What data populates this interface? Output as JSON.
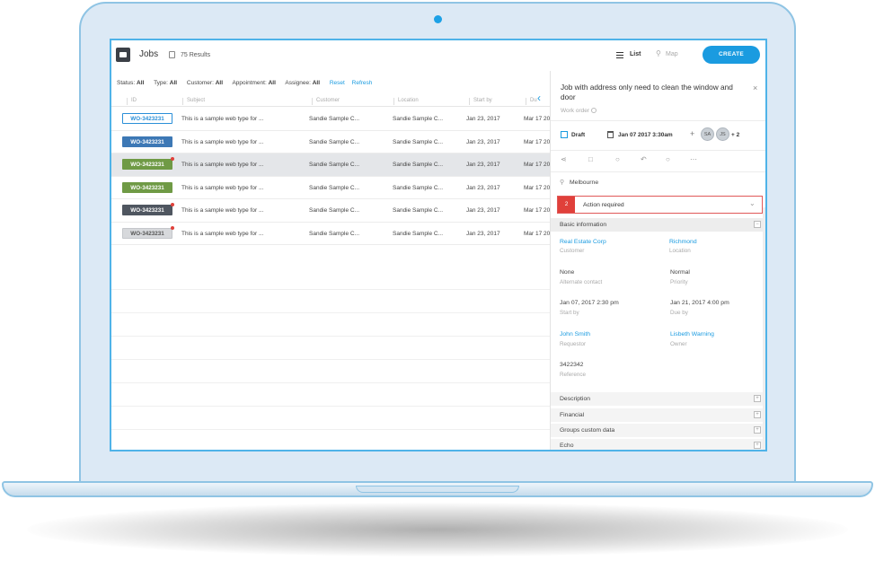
{
  "header": {
    "title": "Jobs",
    "results": "75 Results",
    "list_label": "List",
    "map_label": "Map",
    "create_label": "CREATE"
  },
  "filters": [
    {
      "label": "Status:",
      "value": "All"
    },
    {
      "label": "Type:",
      "value": "All"
    },
    {
      "label": "Customer:",
      "value": "All"
    },
    {
      "label": "Appointment:",
      "value": "All"
    },
    {
      "label": "Assignee:",
      "value": "All"
    }
  ],
  "filter_links": {
    "reset": "Reset",
    "refresh": "Refresh"
  },
  "table": {
    "columns": [
      "ID",
      "Subject",
      "Customer",
      "Location",
      "Start by",
      "Du"
    ],
    "rows": [
      {
        "id": "WO-3423231",
        "subject": "This is a sample web type for ...",
        "customer": "Sandie Sample C...",
        "location": "Sandie Sample C...",
        "start": "Jan 23, 2017",
        "due": "Mar 17 20",
        "badge_bg": "#ffffff",
        "badge_fg": "#2a8fd8",
        "badge_border": "#2a8fd8",
        "dot": false,
        "selected": false
      },
      {
        "id": "WO-3423231",
        "subject": "This is a sample web type for ...",
        "customer": "Sandie Sample C...",
        "location": "Sandie Sample C...",
        "start": "Jan 23, 2017",
        "due": "Mar 17 20",
        "badge_bg": "#3d78b5",
        "badge_fg": "#ffffff",
        "badge_border": "#3d78b5",
        "dot": false,
        "selected": false
      },
      {
        "id": "WO-3423231",
        "subject": "This is a sample web type for ...",
        "customer": "Sandie Sample C...",
        "location": "Sandie Sample C...",
        "start": "Jan 23, 2017",
        "due": "Mar 17 20",
        "badge_bg": "#6f9a45",
        "badge_fg": "#ffffff",
        "badge_border": "#6f9a45",
        "dot": true,
        "selected": true
      },
      {
        "id": "WO-3423231",
        "subject": "This is a sample web type for ...",
        "customer": "Sandie Sample C...",
        "location": "Sandie Sample C...",
        "start": "Jan 23, 2017",
        "due": "Mar 17 20",
        "badge_bg": "#6f9a45",
        "badge_fg": "#ffffff",
        "badge_border": "#6f9a45",
        "dot": false,
        "selected": false
      },
      {
        "id": "WO-3423231",
        "subject": "This is a sample web type for ...",
        "customer": "Sandie Sample C...",
        "location": "Sandie Sample C...",
        "start": "Jan 23, 2017",
        "due": "Mar 17 20",
        "badge_bg": "#4f5660",
        "badge_fg": "#ffffff",
        "badge_border": "#4f5660",
        "dot": true,
        "selected": false
      },
      {
        "id": "WO-3423231",
        "subject": "This is a sample web type for ...",
        "customer": "Sandie Sample C...",
        "location": "Sandie Sample C...",
        "start": "Jan 23, 2017",
        "due": "Mar 17 20",
        "badge_bg": "#d7d9dc",
        "badge_fg": "#555555",
        "badge_border": "#c4c7cb",
        "dot": true,
        "selected": false
      }
    ]
  },
  "panel": {
    "title": "Job with address only need to clean the window and door",
    "type": "Work order",
    "status": "Draft",
    "date": "Jan 07 2017 3:30am",
    "avatars": [
      "SA",
      "JS"
    ],
    "more": "+ 2",
    "location": "Melbourne",
    "alert_count": "2",
    "alert_text": "Action required",
    "basic_info_label": "Basic information",
    "fields": [
      {
        "value": "Real Estate Corp",
        "caption": "Customer",
        "link": true
      },
      {
        "value": "Richmond",
        "caption": "Location",
        "link": true
      },
      {
        "value": "None",
        "caption": "Alternate contact",
        "link": false
      },
      {
        "value": "Normal",
        "caption": "Priority",
        "link": false
      },
      {
        "value": "Jan 07, 2017 2:30 pm",
        "caption": "Start by",
        "link": false
      },
      {
        "value": "Jan 21, 2017 4:00 pm",
        "caption": "Due by",
        "link": false
      },
      {
        "value": "John Smith",
        "caption": "Requestor",
        "link": true
      },
      {
        "value": "Lisbeth Warning",
        "caption": "Owner",
        "link": true
      },
      {
        "value": "3422342",
        "caption": "Reference",
        "link": false
      }
    ],
    "sections": [
      "Description",
      "Financial",
      "Groups custom data",
      "Echo"
    ]
  },
  "colors": {
    "accent": "#1a9be0",
    "alert": "#e0403a",
    "frame": "#8fc4e4"
  }
}
